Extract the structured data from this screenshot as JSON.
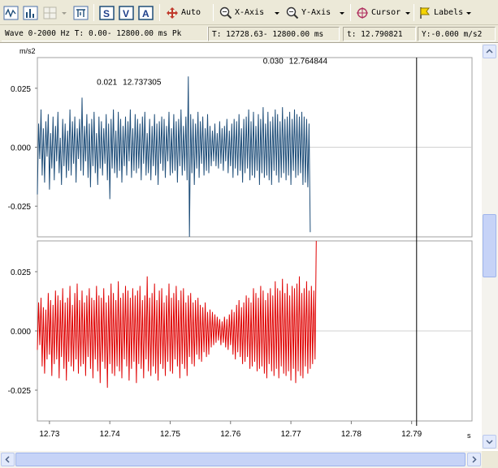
{
  "toolbar": {
    "auto_label": "Auto",
    "xaxis_label": "X-Axis",
    "yaxis_label": "Y-Axis",
    "cursor_label": "Cursor",
    "labels_label": "Labels",
    "s_label": "S",
    "v_label": "V",
    "a_label": "A"
  },
  "status": {
    "wave": "Wave 0-2000 Hz  T: 0.00- 12800.00 ms  Pk",
    "range": "T: 12728.63- 12800.00 ms",
    "t": "t: 12.790821",
    "y": "Y:-0.000 m/s2"
  },
  "colors": {
    "series1": "#1f4e79",
    "series2": "#e00000",
    "cursor": "#000000"
  },
  "chart_data": {
    "type": "line",
    "units_y": "m/s2",
    "units_x": "s",
    "xlim": [
      12.728,
      12.8
    ],
    "x_ticks": [
      "12.73",
      "12.74",
      "12.75",
      "12.76",
      "12.77",
      "12.78",
      "12.79"
    ],
    "x_tick_values": [
      12.73,
      12.74,
      12.75,
      12.76,
      12.77,
      12.78,
      12.79
    ],
    "cursor_x": 12.790821,
    "panels": [
      {
        "ylabel": "m/s2",
        "ylim": [
          -0.038,
          0.038
        ],
        "y_ticks": [
          "0.025",
          "0.000",
          "-0.025"
        ],
        "y_tick_values": [
          0.025,
          0.0,
          -0.025
        ],
        "annotations": [
          {
            "x": 12.737305,
            "y": 0.021,
            "value_text": "0.021",
            "time_text": "12.737305"
          },
          {
            "x": 12.764844,
            "y": 0.03,
            "value_text": "0.030",
            "time_text": "12.764844"
          }
        ],
        "series": {
          "x_start": 12.728,
          "x_step": 0.0002,
          "values": [
            -0.02,
            0.01,
            -0.005,
            0.016,
            -0.012,
            0.008,
            -0.015,
            0.011,
            -0.004,
            0.014,
            -0.018,
            0.006,
            -0.009,
            0.013,
            -0.014,
            0.009,
            -0.006,
            0.015,
            -0.011,
            0.004,
            -0.016,
            0.012,
            -0.008,
            0.01,
            -0.013,
            0.007,
            -0.01,
            0.016,
            -0.012,
            0.011,
            -0.007,
            0.013,
            -0.015,
            0.008,
            -0.005,
            0.012,
            -0.01,
            0.021,
            -0.012,
            0.009,
            -0.006,
            0.014,
            -0.013,
            0.01,
            -0.017,
            0.012,
            -0.008,
            0.015,
            -0.011,
            0.006,
            -0.016,
            0.013,
            -0.009,
            0.011,
            -0.012,
            0.008,
            -0.007,
            0.014,
            -0.014,
            0.01,
            -0.022,
            0.012,
            -0.009,
            0.016,
            -0.011,
            0.007,
            -0.013,
            0.015,
            -0.01,
            0.012,
            -0.015,
            0.009,
            -0.008,
            0.013,
            -0.012,
            0.011,
            -0.006,
            0.016,
            -0.013,
            0.008,
            -0.01,
            0.014,
            -0.011,
            0.012,
            -0.009,
            0.01,
            -0.014,
            0.013,
            -0.007,
            0.015,
            -0.012,
            0.006,
            -0.011,
            0.012,
            -0.014,
            0.009,
            -0.008,
            0.014,
            -0.012,
            0.01,
            -0.016,
            0.011,
            -0.007,
            0.013,
            -0.01,
            0.012,
            -0.013,
            0.009,
            -0.006,
            0.015,
            -0.012,
            0.008,
            -0.011,
            0.014,
            -0.01,
            0.011,
            -0.015,
            0.012,
            -0.008,
            0.016,
            -0.012,
            0.009,
            -0.01,
            0.013,
            -0.014,
            0.03,
            -0.038,
            0.014,
            -0.011,
            0.012,
            -0.016,
            0.01,
            -0.009,
            0.015,
            -0.013,
            0.011,
            -0.007,
            0.013,
            -0.012,
            0.008,
            -0.01,
            0.014,
            -0.011,
            0.009,
            -0.008,
            0.007,
            -0.006,
            0.01,
            -0.008,
            0.006,
            -0.009,
            0.011,
            -0.007,
            0.008,
            -0.01,
            0.009,
            -0.006,
            0.012,
            -0.011,
            0.007,
            -0.008,
            0.01,
            -0.013,
            0.012,
            -0.009,
            0.011,
            -0.012,
            0.014,
            -0.01,
            0.008,
            -0.015,
            0.012,
            -0.011,
            0.013,
            -0.009,
            0.016,
            -0.014,
            0.011,
            -0.012,
            0.015,
            -0.013,
            0.009,
            -0.01,
            0.014,
            -0.016,
            0.012,
            -0.011,
            0.017,
            -0.013,
            0.01,
            -0.012,
            0.015,
            -0.014,
            0.011,
            -0.016,
            0.013,
            -0.01,
            0.016,
            -0.012,
            0.014,
            -0.015,
            0.011,
            -0.013,
            0.017,
            -0.011,
            0.012,
            -0.014,
            0.013,
            -0.012,
            0.015,
            -0.016,
            0.012,
            -0.01,
            0.016,
            -0.013,
            0.014,
            -0.012,
            0.013,
            -0.011,
            0.015,
            -0.016,
            0.013,
            -0.015,
            0.012,
            -0.017,
            0.01,
            -0.036
          ]
        }
      },
      {
        "ylim": [
          -0.038,
          0.038
        ],
        "y_ticks": [
          "0.025",
          "0.000",
          "-0.025"
        ],
        "y_tick_values": [
          0.025,
          0.0,
          -0.025
        ],
        "series": {
          "x_start": 12.728,
          "x_step": 0.0002,
          "values": [
            -0.008,
            0.012,
            -0.006,
            0.014,
            -0.015,
            0.01,
            -0.018,
            0.009,
            -0.012,
            0.016,
            -0.01,
            0.013,
            -0.019,
            0.011,
            -0.014,
            0.017,
            -0.012,
            0.015,
            -0.02,
            0.013,
            -0.011,
            0.018,
            -0.016,
            0.012,
            -0.021,
            0.014,
            -0.013,
            0.019,
            -0.015,
            0.011,
            -0.017,
            0.016,
            -0.012,
            0.02,
            -0.018,
            0.013,
            -0.015,
            0.017,
            -0.014,
            0.012,
            -0.019,
            0.015,
            -0.011,
            0.018,
            -0.016,
            0.014,
            -0.02,
            0.013,
            -0.012,
            0.019,
            -0.017,
            0.015,
            -0.022,
            0.014,
            -0.013,
            0.018,
            -0.016,
            0.012,
            -0.024,
            0.015,
            -0.014,
            0.02,
            -0.018,
            0.016,
            -0.019,
            0.013,
            -0.015,
            0.021,
            -0.017,
            0.014,
            -0.02,
            0.016,
            -0.012,
            0.019,
            -0.015,
            0.017,
            -0.021,
            0.014,
            -0.016,
            0.018,
            -0.013,
            0.015,
            -0.022,
            0.017,
            -0.014,
            0.019,
            -0.016,
            0.013,
            -0.02,
            0.015,
            -0.012,
            0.023,
            -0.017,
            0.014,
            -0.019,
            0.016,
            -0.015,
            0.02,
            -0.018,
            0.013,
            -0.021,
            0.017,
            -0.014,
            0.018,
            -0.016,
            0.012,
            -0.019,
            0.015,
            -0.013,
            0.02,
            -0.017,
            0.014,
            -0.018,
            0.016,
            -0.012,
            0.019,
            -0.015,
            0.013,
            -0.02,
            0.017,
            -0.014,
            0.018,
            -0.016,
            0.012,
            -0.019,
            0.015,
            -0.011,
            0.016,
            -0.014,
            0.012,
            -0.015,
            0.013,
            -0.01,
            0.014,
            -0.012,
            0.011,
            -0.013,
            0.01,
            -0.009,
            0.012,
            -0.011,
            0.008,
            -0.01,
            0.009,
            -0.007,
            0.008,
            -0.006,
            0.007,
            -0.005,
            0.006,
            -0.004,
            0.005,
            -0.006,
            0.004,
            -0.005,
            0.006,
            -0.007,
            0.005,
            -0.008,
            0.007,
            -0.006,
            0.009,
            -0.01,
            0.008,
            -0.012,
            0.011,
            -0.009,
            0.013,
            -0.011,
            0.01,
            -0.014,
            0.012,
            -0.013,
            0.015,
            -0.011,
            0.014,
            -0.016,
            0.012,
            -0.015,
            0.018,
            -0.013,
            0.016,
            -0.017,
            0.014,
            -0.016,
            0.019,
            -0.015,
            0.017,
            -0.018,
            0.013,
            -0.02,
            0.016,
            -0.014,
            0.018,
            -0.017,
            0.015,
            -0.019,
            0.021,
            -0.016,
            0.018,
            -0.02,
            0.017,
            -0.015,
            0.022,
            -0.018,
            0.016,
            -0.019,
            0.02,
            -0.017,
            0.015,
            -0.021,
            0.019,
            -0.016,
            0.018,
            -0.022,
            0.02,
            -0.017,
            0.023,
            -0.019,
            0.016,
            -0.02,
            0.018,
            -0.015,
            0.021,
            -0.018,
            0.017,
            -0.016,
            0.019,
            -0.014,
            0.017,
            -0.012,
            0.038
          ]
        }
      }
    ]
  }
}
